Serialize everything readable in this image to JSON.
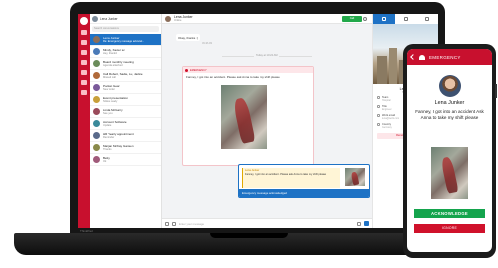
{
  "laptop": {
    "brand": "ThinkPad"
  },
  "convlist": {
    "title": "Lena Junker",
    "search_placeholder": "Search conversations",
    "items": [
      {
        "name": "Lena Junker",
        "preview": "Re: Emergency message acknowl...",
        "color": "#8a6d5a",
        "active": true
      },
      {
        "name": "Mindy, Xavier sc",
        "preview": "Hey, thanks!",
        "color": "#4a7ab8",
        "active": false
      },
      {
        "name": "Board monthly meeting",
        "preview": "Agenda attached",
        "color": "#6a8c5a",
        "active": false
      },
      {
        "name": "Call Robert, Sadie, Lu, Jackie",
        "preview": "Missed call",
        "color": "#b06a3a",
        "active": false
      },
      {
        "name": "Pocket Gear",
        "preview": "New order",
        "color": "#7a5a9a",
        "active": false
      },
      {
        "name": "Event presentation",
        "preview": "Slides ready",
        "color": "#c8a03a",
        "active": false
      },
      {
        "name": "Linda McGarry",
        "preview": "See you",
        "color": "#9a4a5a",
        "active": false
      },
      {
        "name": "Account Software",
        "preview": "Update",
        "color": "#3a8a9a",
        "active": false
      },
      {
        "name": "HR Yearly appointment",
        "preview": "Reminder",
        "color": "#5a6a8a",
        "active": false
      },
      {
        "name": "Marjan McKay Gansen",
        "preview": "Thanks",
        "color": "#8a8a4a",
        "active": false
      },
      {
        "name": "Betty",
        "preview": "Ok",
        "color": "#a05a7a",
        "active": false
      }
    ]
  },
  "chat": {
    "header_name": "Lena Junker",
    "header_sub": "Online",
    "call_label": "Call",
    "first_message": "Okay, thanks :)",
    "first_ts": "09:48 AM",
    "divider_label": "Today at 10:22 AM",
    "emergency_label": "EMERGENCY",
    "emergency_text": "Fanney, I got into an accident. Please ask Anna to take my shift please",
    "emergency_ts": "10:22 AM",
    "reply_author": "Lena Junker",
    "reply_quote": "Fanney, I got into an accident. Please ask Anna to take my shift please",
    "ack_text": "Emergency message acknowledged",
    "composer_placeholder": "Enter your message"
  },
  "info": {
    "name": "Lena J.",
    "role": "Nurse",
    "rows": [
      {
        "k": "Team",
        "v": "Hospital"
      },
      {
        "k": "Title",
        "v": "Engineer"
      },
      {
        "k": "Work email",
        "v": "lena@work.com"
      },
      {
        "k": "Country",
        "v": "Germany"
      }
    ],
    "remove_label": "Remove contact"
  },
  "phone": {
    "title": "EMERGENCY",
    "name": "Lena Junker",
    "message": "Fanney, I got into an accident Ask Anna to take my shift please",
    "ack_label": "ACKNOWLEDGE",
    "ignore_label": "IGNORE"
  },
  "colors": {
    "brand_red": "#c8102e",
    "accent_blue": "#1e72c5",
    "ack_green": "#14a44d"
  }
}
